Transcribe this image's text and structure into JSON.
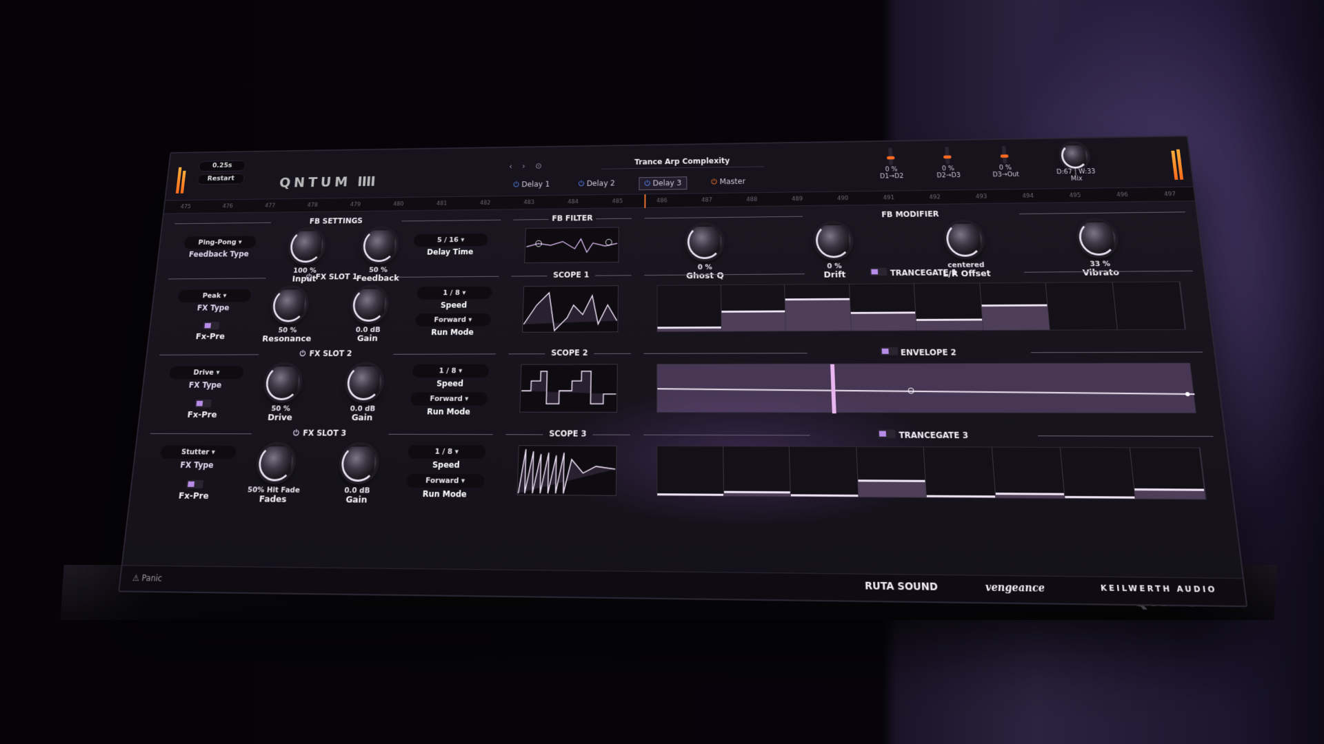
{
  "top": {
    "time": "0.25s",
    "restart": "Restart",
    "logo": "Q N T U M",
    "logo_tail": "IIII",
    "icons": "‹ › ⊙",
    "preset": "Trance Arp Complexity",
    "tabs": [
      {
        "label": "Delay 1"
      },
      {
        "label": "Delay 2"
      },
      {
        "label": "Delay 3",
        "active": true
      },
      {
        "label": "Master"
      }
    ],
    "sliders": [
      {
        "value": "0 %",
        "label": "D1→D2"
      },
      {
        "value": "0 %",
        "label": "D2→D3"
      },
      {
        "value": "0 %",
        "label": "D3→Out"
      }
    ],
    "mix": {
      "value": "D:67 | W:33",
      "label": "Mix"
    }
  },
  "ruler": [
    "475",
    "476",
    "477",
    "478",
    "479",
    "480",
    "481",
    "482",
    "483",
    "484",
    "485",
    "486",
    "487",
    "488",
    "489",
    "490",
    "491",
    "492",
    "493",
    "494",
    "495",
    "496",
    "497"
  ],
  "fb_settings": {
    "title": "FB SETTINGS",
    "feedback_type": {
      "value": "Ping-Pong",
      "label": "Feedback Type"
    },
    "input": {
      "value": "100 %",
      "label": "Input"
    },
    "feedback": {
      "value": "50 %",
      "label": "Feedback"
    },
    "delay_time": {
      "value": "5 / 16",
      "label": "Delay Time"
    }
  },
  "fb_filter": {
    "title": "FB FILTER"
  },
  "fb_modifier": {
    "title": "FB MODIFIER",
    "knobs": [
      {
        "value": "0 %",
        "label": "Ghost Q"
      },
      {
        "value": "0 %",
        "label": "Drift"
      },
      {
        "value": "centered",
        "label": "L/R Offset"
      },
      {
        "value": "33 %",
        "label": "Vibrato"
      }
    ]
  },
  "slots": [
    {
      "title": "FX SLOT 1",
      "fx_type": {
        "value": "Peak",
        "label": "FX Type"
      },
      "fxpre": "Fx-Pre",
      "k1": {
        "value": "50 %",
        "label": "Resonance"
      },
      "k2": {
        "value": "0.0 dB",
        "label": "Gain"
      },
      "speed": {
        "value": "1 / 8",
        "label": "Speed"
      },
      "run": {
        "value": "Forward",
        "label": "Run Mode"
      },
      "scope": "SCOPE 1",
      "mod": "TRANCEGATE 1"
    },
    {
      "title": "FX SLOT 2",
      "fx_type": {
        "value": "Drive",
        "label": "FX Type"
      },
      "fxpre": "Fx-Pre",
      "k1": {
        "value": "50 %",
        "label": "Drive"
      },
      "k2": {
        "value": "0.0 dB",
        "label": "Gain"
      },
      "speed": {
        "value": "1 / 8",
        "label": "Speed"
      },
      "run": {
        "value": "Forward",
        "label": "Run Mode"
      },
      "scope": "SCOPE 2",
      "mod": "ENVELOPE 2"
    },
    {
      "title": "FX SLOT 3",
      "fx_type": {
        "value": "Stutter",
        "label": "FX Type"
      },
      "fxpre": "Fx-Pre",
      "k1": {
        "value": "50% Hit Fade",
        "label": "Fades"
      },
      "k2": {
        "value": "0.0 dB",
        "label": "Gain"
      },
      "speed": {
        "value": "1 / 8",
        "label": "Speed"
      },
      "run": {
        "value": "Forward",
        "label": "Run Mode"
      },
      "scope": "SCOPE 3",
      "mod": "TRANCEGATE 3"
    }
  ],
  "gate1": [
    0.1,
    0.45,
    0.7,
    0.4,
    0.25,
    0.55,
    0,
    0
  ],
  "gate3": [
    0.05,
    0.1,
    0.05,
    0.35,
    0.05,
    0.1,
    0.05,
    0.2
  ],
  "footer": {
    "panic": "Panic",
    "ruta": "RUTA SOUND",
    "veng": "vengeance",
    "keil": "KEILWERTH AUDIO"
  },
  "base_logo": "QNTUM"
}
